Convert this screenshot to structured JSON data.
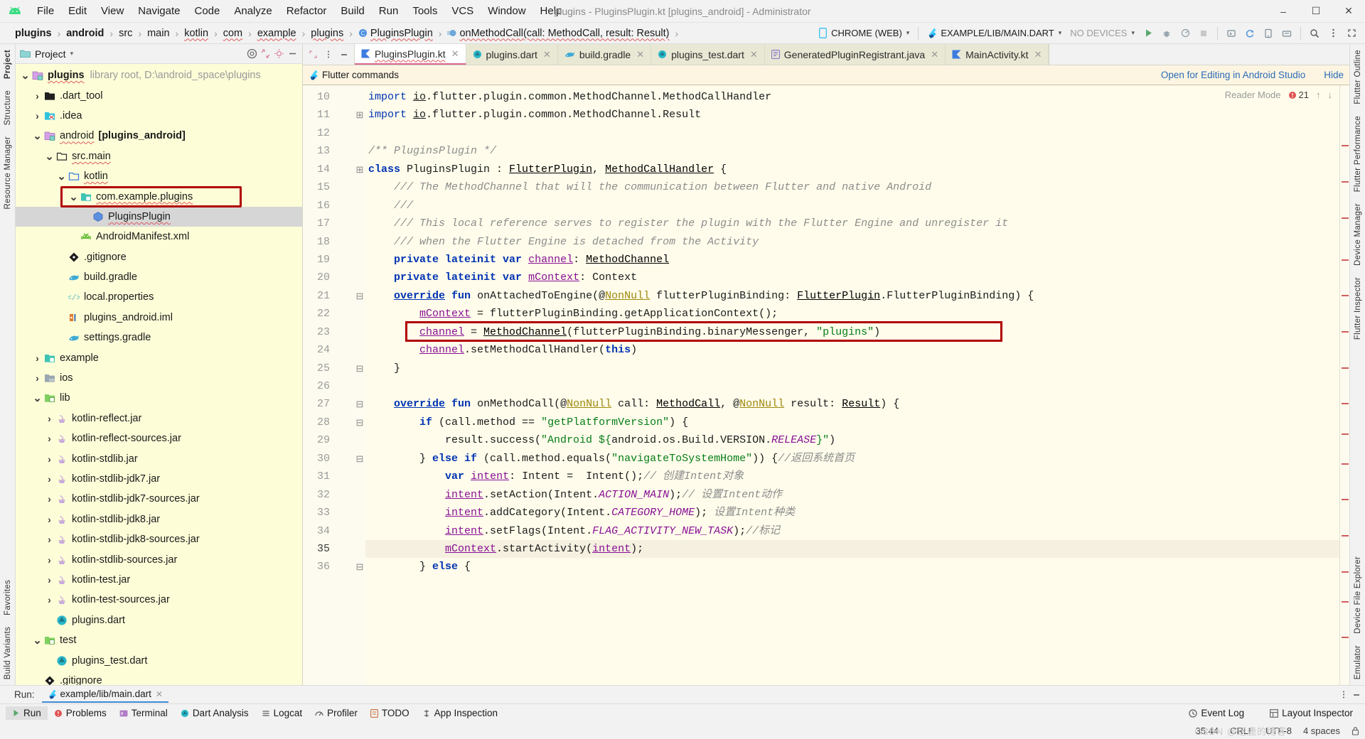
{
  "window": {
    "title": "plugins - PluginsPlugin.kt [plugins_android] - Administrator",
    "minimize": "–",
    "maximize": "☐",
    "close": "✕"
  },
  "menu": [
    "File",
    "Edit",
    "View",
    "Navigate",
    "Code",
    "Analyze",
    "Refactor",
    "Build",
    "Run",
    "Tools",
    "VCS",
    "Window",
    "Help"
  ],
  "breadcrumbs": [
    {
      "label": "plugins",
      "bold": true,
      "squiggle": false
    },
    {
      "label": "android",
      "bold": true,
      "squiggle": false
    },
    {
      "label": "src",
      "bold": false,
      "squiggle": false
    },
    {
      "label": "main",
      "bold": false,
      "squiggle": false
    },
    {
      "label": "kotlin",
      "bold": false,
      "squiggle": true
    },
    {
      "label": "com",
      "bold": false,
      "squiggle": true
    },
    {
      "label": "example",
      "bold": false,
      "squiggle": true
    },
    {
      "label": "plugins",
      "bold": false,
      "squiggle": true
    },
    {
      "label": "PluginsPlugin",
      "bold": false,
      "squiggle": true,
      "icon": "kotlin-class-icon"
    },
    {
      "label": "onMethodCall(call: MethodCall, result: Result)",
      "bold": false,
      "squiggle": true,
      "icon": "method-icon"
    }
  ],
  "toolbar": {
    "device_target": "CHROME (WEB)",
    "run_config": "EXAMPLE/LIB/MAIN.DART",
    "no_devices": "NO DEVICES",
    "caret": "▾",
    "icons": [
      "run-icon",
      "debug-icon",
      "profile-icon",
      "stop-icon",
      "attach-debugger-icon",
      "sync-gradle-icon",
      "avd-manager-icon",
      "sdk-manager-icon",
      "search-everywhere-icon",
      "more-icon"
    ]
  },
  "left_strip": {
    "top": [
      "Project",
      "Structure",
      "Resource Manager"
    ],
    "bottom": [
      "Favorites",
      "Build Variants"
    ]
  },
  "right_strip": {
    "top": [
      "Flutter Outline",
      "Flutter Performance",
      "Device Manager",
      "Flutter Inspector"
    ],
    "bottom": [
      "Device File Explorer",
      "Emulator"
    ]
  },
  "project_panel": {
    "title": "Project",
    "caret": "▾",
    "header_icons": [
      "target-icon",
      "collapse-all-icon",
      "settings-icon",
      "hide-icon"
    ],
    "tree": [
      {
        "depth": 0,
        "arrow": "down",
        "icon": "module-root-icon",
        "label": "plugins",
        "bold": true,
        "meta": "library root,  D:\\android_space\\plugins",
        "squiggle": true,
        "selected": false
      },
      {
        "depth": 1,
        "arrow": "right",
        "icon": "folder-dark-icon",
        "label": ".dart_tool",
        "bold": false,
        "meta": "",
        "squiggle": false,
        "selected": false
      },
      {
        "depth": 1,
        "arrow": "right",
        "icon": "idea-folder-icon",
        "label": ".idea",
        "bold": false,
        "meta": "",
        "squiggle": false,
        "selected": false
      },
      {
        "depth": 1,
        "arrow": "down",
        "icon": "module-root-icon",
        "label": "android",
        "bold": false,
        "meta": "[plugins_android]",
        "metaBold": true,
        "squiggle": true,
        "selected": false
      },
      {
        "depth": 2,
        "arrow": "down",
        "icon": "folder-plain-icon",
        "label": "src.main",
        "bold": false,
        "meta": "",
        "squiggle": true,
        "selected": false
      },
      {
        "depth": 3,
        "arrow": "down",
        "icon": "source-folder-icon",
        "label": "kotlin",
        "bold": false,
        "meta": "",
        "squiggle": true,
        "selected": false
      },
      {
        "depth": 4,
        "arrow": "down",
        "icon": "package-icon",
        "label": "com.example.plugins",
        "bold": false,
        "meta": "",
        "squiggle": true,
        "selected": false,
        "highlight": true
      },
      {
        "depth": 5,
        "arrow": "none",
        "icon": "kotlin-class-icon",
        "label": "PluginsPlugin",
        "bold": false,
        "meta": "",
        "squiggle": true,
        "selected": true
      },
      {
        "depth": 4,
        "arrow": "none",
        "icon": "android-manifest-icon",
        "label": "AndroidManifest.xml",
        "bold": false,
        "meta": "",
        "squiggle": false,
        "selected": false
      },
      {
        "depth": 3,
        "arrow": "none",
        "icon": "git-icon",
        "label": ".gitignore",
        "bold": false,
        "meta": "",
        "squiggle": false,
        "selected": false
      },
      {
        "depth": 3,
        "arrow": "none",
        "icon": "gradle-icon",
        "label": "build.gradle",
        "bold": false,
        "meta": "",
        "squiggle": false,
        "selected": false
      },
      {
        "depth": 3,
        "arrow": "none",
        "icon": "properties-icon",
        "label": "local.properties",
        "bold": false,
        "meta": "",
        "squiggle": false,
        "selected": false
      },
      {
        "depth": 3,
        "arrow": "none",
        "icon": "iml-icon",
        "label": "plugins_android.iml",
        "bold": false,
        "meta": "",
        "squiggle": false,
        "selected": false
      },
      {
        "depth": 3,
        "arrow": "none",
        "icon": "gradle-icon",
        "label": "settings.gradle",
        "bold": false,
        "meta": "",
        "squiggle": false,
        "selected": false
      },
      {
        "depth": 1,
        "arrow": "right",
        "icon": "module-folder-icon",
        "label": "example",
        "bold": false,
        "meta": "",
        "squiggle": false,
        "selected": false
      },
      {
        "depth": 1,
        "arrow": "right",
        "icon": "ios-folder-icon",
        "label": "ios",
        "bold": false,
        "meta": "",
        "squiggle": false,
        "selected": false
      },
      {
        "depth": 1,
        "arrow": "down",
        "icon": "lib-folder-icon",
        "label": "lib",
        "bold": false,
        "meta": "",
        "squiggle": false,
        "selected": false
      },
      {
        "depth": 2,
        "arrow": "right",
        "icon": "jar-icon",
        "label": "kotlin-reflect.jar",
        "bold": false,
        "meta": "",
        "squiggle": false,
        "selected": false
      },
      {
        "depth": 2,
        "arrow": "right",
        "icon": "jar-icon",
        "label": "kotlin-reflect-sources.jar",
        "bold": false,
        "meta": "",
        "squiggle": false,
        "selected": false
      },
      {
        "depth": 2,
        "arrow": "right",
        "icon": "jar-icon",
        "label": "kotlin-stdlib.jar",
        "bold": false,
        "meta": "",
        "squiggle": false,
        "selected": false
      },
      {
        "depth": 2,
        "arrow": "right",
        "icon": "jar-icon",
        "label": "kotlin-stdlib-jdk7.jar",
        "bold": false,
        "meta": "",
        "squiggle": false,
        "selected": false
      },
      {
        "depth": 2,
        "arrow": "right",
        "icon": "jar-icon",
        "label": "kotlin-stdlib-jdk7-sources.jar",
        "bold": false,
        "meta": "",
        "squiggle": false,
        "selected": false
      },
      {
        "depth": 2,
        "arrow": "right",
        "icon": "jar-icon",
        "label": "kotlin-stdlib-jdk8.jar",
        "bold": false,
        "meta": "",
        "squiggle": false,
        "selected": false
      },
      {
        "depth": 2,
        "arrow": "right",
        "icon": "jar-icon",
        "label": "kotlin-stdlib-jdk8-sources.jar",
        "bold": false,
        "meta": "",
        "squiggle": false,
        "selected": false
      },
      {
        "depth": 2,
        "arrow": "right",
        "icon": "jar-icon",
        "label": "kotlin-stdlib-sources.jar",
        "bold": false,
        "meta": "",
        "squiggle": false,
        "selected": false
      },
      {
        "depth": 2,
        "arrow": "right",
        "icon": "jar-icon",
        "label": "kotlin-test.jar",
        "bold": false,
        "meta": "",
        "squiggle": false,
        "selected": false
      },
      {
        "depth": 2,
        "arrow": "right",
        "icon": "jar-icon",
        "label": "kotlin-test-sources.jar",
        "bold": false,
        "meta": "",
        "squiggle": false,
        "selected": false
      },
      {
        "depth": 2,
        "arrow": "none",
        "icon": "dart-icon",
        "label": "plugins.dart",
        "bold": false,
        "meta": "",
        "squiggle": false,
        "selected": false
      },
      {
        "depth": 1,
        "arrow": "down",
        "icon": "test-folder-icon",
        "label": "test",
        "bold": false,
        "meta": "",
        "squiggle": false,
        "selected": false
      },
      {
        "depth": 2,
        "arrow": "none",
        "icon": "dart-icon",
        "label": "plugins_test.dart",
        "bold": false,
        "meta": "",
        "squiggle": false,
        "selected": false
      },
      {
        "depth": 1,
        "arrow": "none",
        "icon": "git-icon",
        "label": ".gitignore",
        "bold": false,
        "meta": "",
        "squiggle": false,
        "selected": false
      }
    ]
  },
  "editor_tabs": [
    {
      "label": "PluginsPlugin.kt",
      "icon": "kotlin-file-icon",
      "active": true,
      "squiggle": true
    },
    {
      "label": "plugins.dart",
      "icon": "dart-icon",
      "active": false,
      "squiggle": false
    },
    {
      "label": "build.gradle",
      "icon": "gradle-icon",
      "active": false,
      "squiggle": false
    },
    {
      "label": "plugins_test.dart",
      "icon": "dart-icon",
      "active": false,
      "squiggle": false
    },
    {
      "label": "GeneratedPluginRegistrant.java",
      "icon": "java-icon",
      "active": false,
      "squiggle": false
    },
    {
      "label": "MainActivity.kt",
      "icon": "kotlin-file-icon",
      "active": false,
      "squiggle": false
    }
  ],
  "notification_bar": {
    "label": "Flutter commands",
    "icon": "flutter-icon",
    "open_link": "Open for Editing in Android Studio",
    "hide_link": "Hide"
  },
  "editor": {
    "reader_mode": "Reader Mode",
    "error_count": "21",
    "up_arrow": "↑",
    "down_arrow": "↓",
    "first_line": 10,
    "current_line": 35,
    "lines": [
      {
        "n": 10,
        "fold": "",
        "html": "<span class='kw'>import</span> <span class='u'>io</span>.flutter.plugin.common.MethodChannel.MethodCallHandler"
      },
      {
        "n": 11,
        "fold": "c",
        "html": "<span class='kw'>import</span> <span class='u'>io</span>.flutter.plugin.common.MethodChannel.Result"
      },
      {
        "n": 12,
        "fold": "",
        "html": ""
      },
      {
        "n": 13,
        "fold": "",
        "html": "<span class='doc'>/** PluginsPlugin */</span>"
      },
      {
        "n": 14,
        "fold": "c",
        "html": "<span class='k'>class</span> PluginsPlugin : <span class='cls'>FlutterPlugin</span>, <span class='cls'>MethodCallHandler</span> {"
      },
      {
        "n": 15,
        "fold": "",
        "html": "    <span class='doc'>/// The MethodChannel that will the communication between Flutter and native Android</span>"
      },
      {
        "n": 16,
        "fold": "",
        "html": "    <span class='doc'>///</span>"
      },
      {
        "n": 17,
        "fold": "",
        "html": "    <span class='doc'>/// This local reference serves to register the plugin with the Flutter Engine and unregister it</span>"
      },
      {
        "n": 18,
        "fold": "",
        "html": "    <span class='doc'>/// when the Flutter Engine is detached from the Activity</span>"
      },
      {
        "n": 19,
        "fold": "",
        "html": "    <span class='k'>private lateinit var</span> <span class='fld u'>channel</span>: <span class='cls'>MethodChannel</span>"
      },
      {
        "n": 20,
        "fold": "",
        "html": "    <span class='k'>private lateinit var</span> <span class='fld u'>mContext</span>: Context"
      },
      {
        "n": 21,
        "fold": "o",
        "html": "    <span class='k u'>override</span> <span class='k'>fun</span> onAttachedToEngine(@<span class='ann u'>NonNull</span> flutterPluginBinding: <span class='cls'>FlutterPlugin</span>.FlutterPluginBinding) {"
      },
      {
        "n": 22,
        "fold": "",
        "html": "        <span class='fld u'>mContext</span> = flutterPluginBinding.getApplicationContext();"
      },
      {
        "n": 23,
        "fold": "",
        "html": "        <span class='fld u'>channel</span> = <span class='cls'>MethodChannel</span>(flutterPluginBinding.binaryMessenger, <span class='str'>\"plugins\"</span>)"
      },
      {
        "n": 24,
        "fold": "",
        "html": "        <span class='fld u'>channel</span>.setMethodCallHandler(<span class='k'>this</span>)"
      },
      {
        "n": 25,
        "fold": "e",
        "html": "    }"
      },
      {
        "n": 26,
        "fold": "",
        "html": ""
      },
      {
        "n": 27,
        "fold": "o",
        "html": "    <span class='k u'>override</span> <span class='k'>fun</span> onMethodCall(@<span class='ann u'>NonNull</span> call: <span class='cls'>MethodCall</span>, @<span class='ann u'>NonNull</span> result: <span class='cls'>Result</span>) {"
      },
      {
        "n": 28,
        "fold": "o",
        "html": "        <span class='k'>if</span> (call.method == <span class='str'>\"getPlatformVersion\"</span>) {"
      },
      {
        "n": 29,
        "fold": "",
        "html": "            result.success(<span class='str'>\"Android ${</span>android.os.Build.VERSION.<span class='purple ital'>RELEASE</span><span class='str'>}\"</span>)"
      },
      {
        "n": 30,
        "fold": "o",
        "html": "        } <span class='k'>else if</span> (call.method.equals(<span class='str'>\"navigateToSystemHome\"</span>)) {<span class='com'>//返回系统首页</span>"
      },
      {
        "n": 31,
        "fold": "",
        "html": "            <span class='k'>var</span> <span class='fld u'>intent</span>: Intent =  Intent();<span class='com'>// 创建Intent对象</span>"
      },
      {
        "n": 32,
        "fold": "",
        "html": "            <span class='fld u'>intent</span>.setAction(Intent.<span class='purple ital'>ACTION_MAIN</span>);<span class='com'>// 设置Intent动作</span>"
      },
      {
        "n": 33,
        "fold": "",
        "html": "            <span class='fld u'>intent</span>.addCategory(Intent.<span class='purple ital'>CATEGORY_HOME</span>);<span class='com'> 设置Intent种类</span>"
      },
      {
        "n": 34,
        "fold": "",
        "html": "            <span class='fld u'>intent</span>.setFlags(Intent.<span class='purple ital'>FLAG_ACTIVITY_NEW_TASK</span>);<span class='com'>//标记</span>"
      },
      {
        "n": 35,
        "fold": "",
        "html": "            <span class='fld u'>mContext</span>.startActivity(<span class='fld u'>intent</span>);"
      },
      {
        "n": 36,
        "fold": "o",
        "html": "        } <span class='k'>else</span> {"
      }
    ],
    "highlight_box_label": "channel = MethodChannel(flutterPluginBinding.binaryMessenger, \"plugins\")"
  },
  "run_panel": {
    "label": "Run:",
    "tab": "example/lib/main.dart",
    "close": "✕",
    "icon": "flutter-icon"
  },
  "tool_windows": [
    {
      "label": "Run",
      "icon": "run-icon",
      "active": true
    },
    {
      "label": "Problems",
      "icon": "problems-icon",
      "active": false
    },
    {
      "label": "Terminal",
      "icon": "terminal-icon",
      "active": false
    },
    {
      "label": "Dart Analysis",
      "icon": "dart-icon",
      "active": false
    },
    {
      "label": "Logcat",
      "icon": "logcat-icon",
      "active": false
    },
    {
      "label": "Profiler",
      "icon": "profiler-icon",
      "active": false
    },
    {
      "label": "TODO",
      "icon": "todo-icon",
      "active": false
    },
    {
      "label": "App Inspection",
      "icon": "app-inspection-icon",
      "active": false
    }
  ],
  "tool_windows_right": [
    {
      "label": "Event Log",
      "icon": "event-log-icon"
    },
    {
      "label": "Layout Inspector",
      "icon": "layout-inspector-icon"
    }
  ],
  "statusbar": {
    "caret_position": "35:44",
    "line_separator": "CRLF",
    "encoding": "UTF-8",
    "indent": "4 spaces",
    "lock_icon": "lock-icon",
    "watermark": "CSDN @迷鹿的博客"
  }
}
